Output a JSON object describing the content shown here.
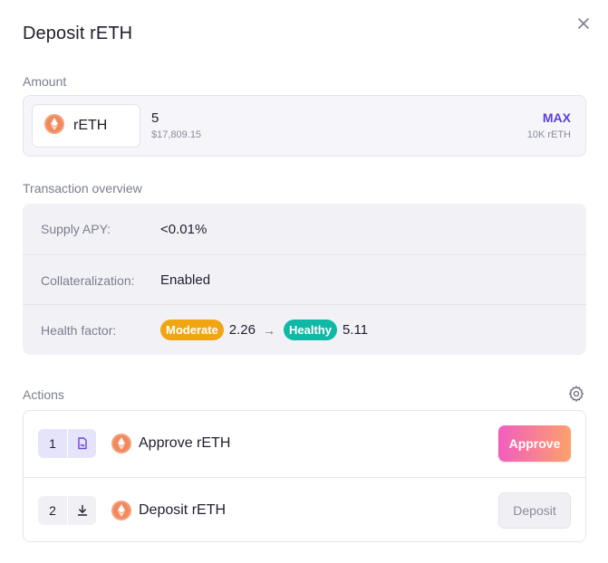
{
  "modal": {
    "title": "Deposit rETH",
    "close_icon": "close-icon"
  },
  "amount": {
    "section_label": "Amount",
    "token_symbol": "rETH",
    "token_icon": "reth-token-icon",
    "value": "5",
    "usd_value": "$17,809.15",
    "max_label": "MAX",
    "balance": "10K rETH"
  },
  "overview": {
    "section_label": "Transaction overview",
    "rows": [
      {
        "label": "Supply APY:",
        "value": "<0.01%"
      },
      {
        "label": "Collateralization:",
        "value": "Enabled"
      },
      {
        "label": "Health factor:",
        "from_status": "Moderate",
        "from_value": "2.26",
        "arrow": "→",
        "to_status": "Healthy",
        "to_value": "5.11"
      }
    ]
  },
  "actions": {
    "section_label": "Actions",
    "settings_icon": "gear-icon",
    "steps": [
      {
        "number": "1",
        "icon": "sign-document-icon",
        "label": "Approve rETH",
        "button": "Approve"
      },
      {
        "number": "2",
        "icon": "download-icon",
        "label": "Deposit rETH",
        "button": "Deposit"
      }
    ]
  },
  "colors": {
    "accent": "#5b3fd6",
    "moderate": "#f1a512",
    "healthy": "#10b8a6",
    "approve_gradient_start": "#f25dbf",
    "approve_gradient_end": "#fca16b"
  }
}
